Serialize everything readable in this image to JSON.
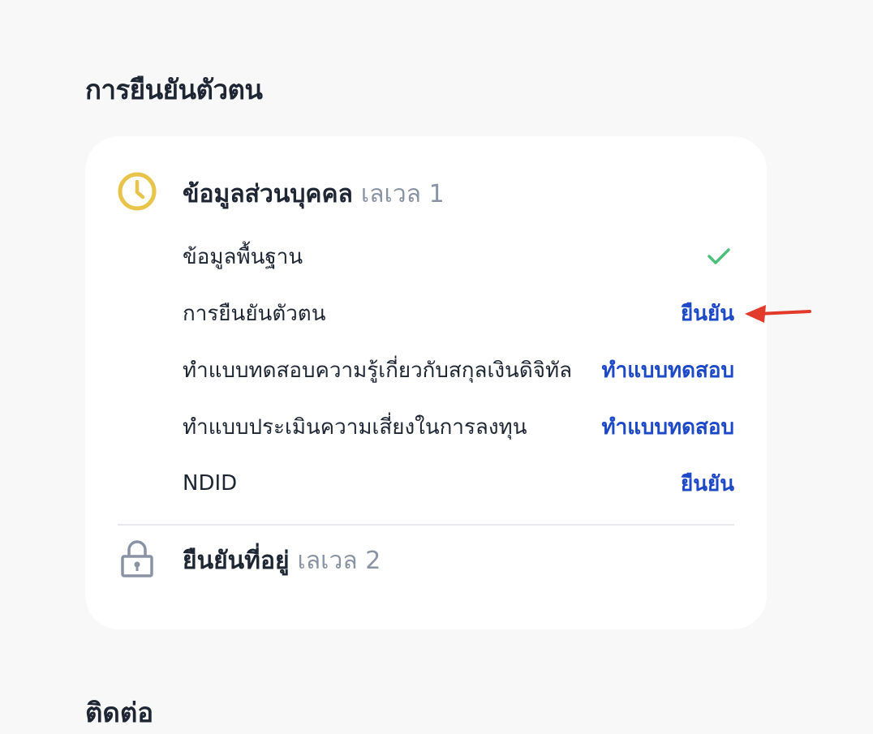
{
  "page": {
    "title": "การยืนยันตัวตน",
    "next_section_title": "ติดต่อ"
  },
  "levels": [
    {
      "name": "ข้อมูลส่วนบุคคล",
      "level_label": "เลเวล 1",
      "status_icon": "clock-icon",
      "rows": [
        {
          "label": "ข้อมูลพื้นฐาน",
          "action": "",
          "status": "complete"
        },
        {
          "label": "การยืนยันตัวตน",
          "action": "ยืนยัน"
        },
        {
          "label": "ทำแบบทดสอบความรู้เกี่ยวกับสกุลเงินดิจิทัล",
          "action": "ทำแบบทดสอบ"
        },
        {
          "label": "ทำแบบประเมินความเสี่ยงในการลงทุน",
          "action": "ทำแบบทดสอบ"
        },
        {
          "label": "NDID",
          "action": "ยืนยัน"
        }
      ]
    },
    {
      "name": "ยืนยันที่อยู่",
      "level_label": "เลเวล 2",
      "status_icon": "lock-icon"
    }
  ],
  "colors": {
    "accent": "#1d49c7",
    "pending": "#e8c54a",
    "success": "#4cc07a",
    "annotation_arrow": "#e23b2b",
    "muted": "#8a93a3"
  }
}
